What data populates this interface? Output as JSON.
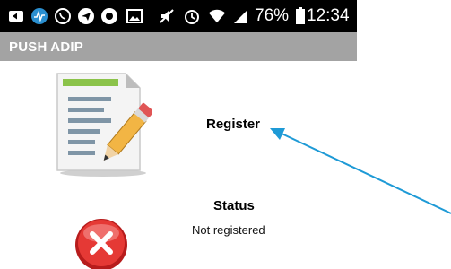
{
  "status_bar": {
    "battery": "76%",
    "time": "12:34",
    "icons": [
      "back-icon",
      "activity-icon",
      "whatsapp-icon",
      "telegram-icon",
      "shield-icon",
      "image-icon",
      "mute-icon",
      "alarm-icon",
      "wifi-icon",
      "signal-icon",
      "battery-icon"
    ]
  },
  "app": {
    "title": "PUSH ADIP"
  },
  "main": {
    "register_label": "Register",
    "status_title": "Status",
    "status_value": "Not registered"
  },
  "colors": {
    "status_bar": "#000000",
    "app_bar": "#a3a3a3",
    "arrow": "#1e9ad6",
    "error_red": "#d32f2f",
    "doc_green": "#8bc34a"
  }
}
